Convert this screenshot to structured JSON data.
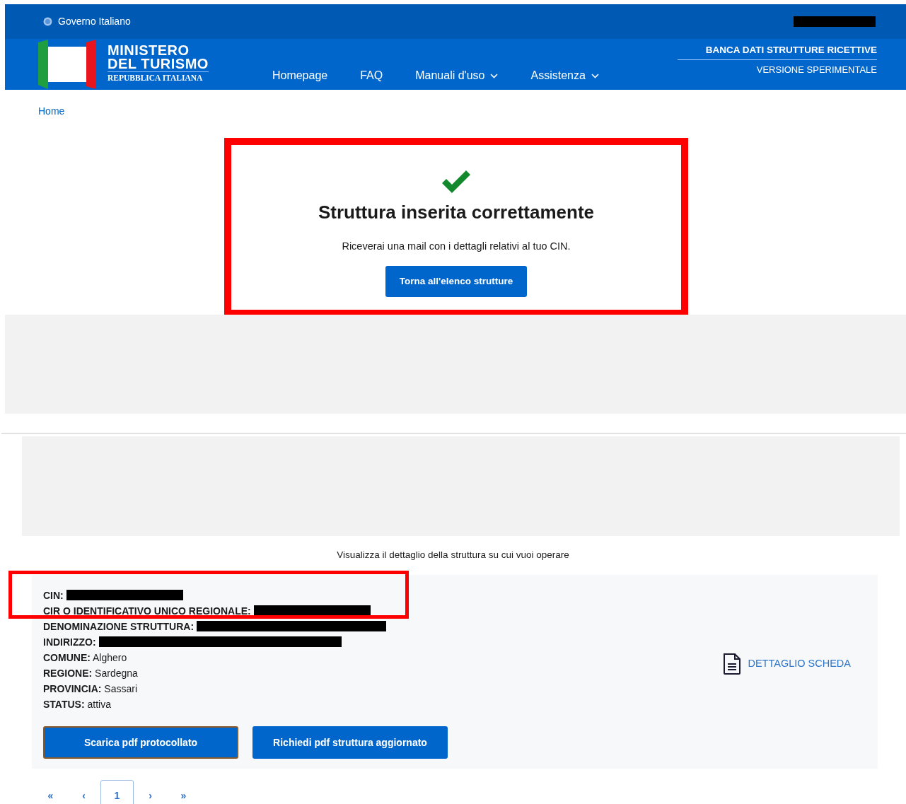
{
  "top_bar": {
    "label": "Governo Italiano",
    "account_redacted": true
  },
  "header": {
    "logo": {
      "line1": "MINISTERO",
      "line2": "DEL TURISMO",
      "line3": "REPUBBLICA ITALIANA"
    },
    "nav": [
      {
        "label": "Homepage",
        "dropdown": false
      },
      {
        "label": "FAQ",
        "dropdown": false
      },
      {
        "label": "Manuali d'uso",
        "dropdown": true
      },
      {
        "label": "Assistenza",
        "dropdown": true
      }
    ],
    "site_title": "BANCA DATI STRUTTURE RICETTIVE",
    "site_subtitle": "VERSIONE SPERIMENTALE"
  },
  "breadcrumb": [
    "Home"
  ],
  "success": {
    "highlighted": true,
    "title": "Struttura inserita correttamente",
    "message": "Riceverai una mail con i dettagli relativi al tuo CIN.",
    "button": "Torna all'elenco strutture"
  },
  "detail": {
    "intro": "Visualizza il dettaglio della struttura su cui vuoi operare",
    "highlighted": true,
    "fields": [
      {
        "label": "CIN:",
        "redacted": true
      },
      {
        "label": "CIR O IDENTIFICATIVO UNICO REGIONALE:",
        "redacted": true
      },
      {
        "label": "DENOMINAZIONE STRUTTURA:",
        "redacted": true
      },
      {
        "label": "INDIRIZZO:",
        "redacted": true
      },
      {
        "label": "COMUNE:",
        "value": "Alghero",
        "redacted": false
      },
      {
        "label": "REGIONE:",
        "value": "Sardegna",
        "redacted": false
      },
      {
        "label": "PROVINCIA:",
        "value": "Sassari",
        "redacted": false
      },
      {
        "label": "STATUS:",
        "value": "attiva",
        "redacted": false
      }
    ],
    "link": "DETTAGLIO SCHEDA",
    "buttons": [
      {
        "label": "Scarica pdf protocollato",
        "focused": true
      },
      {
        "label": "Richiedi pdf struttura aggiornato",
        "focused": false
      }
    ],
    "pagination": [
      {
        "label": "«",
        "selected": false
      },
      {
        "label": "‹",
        "selected": false
      },
      {
        "label": "1",
        "selected": true
      },
      {
        "label": "›",
        "selected": false
      },
      {
        "label": "»",
        "selected": false
      }
    ]
  }
}
